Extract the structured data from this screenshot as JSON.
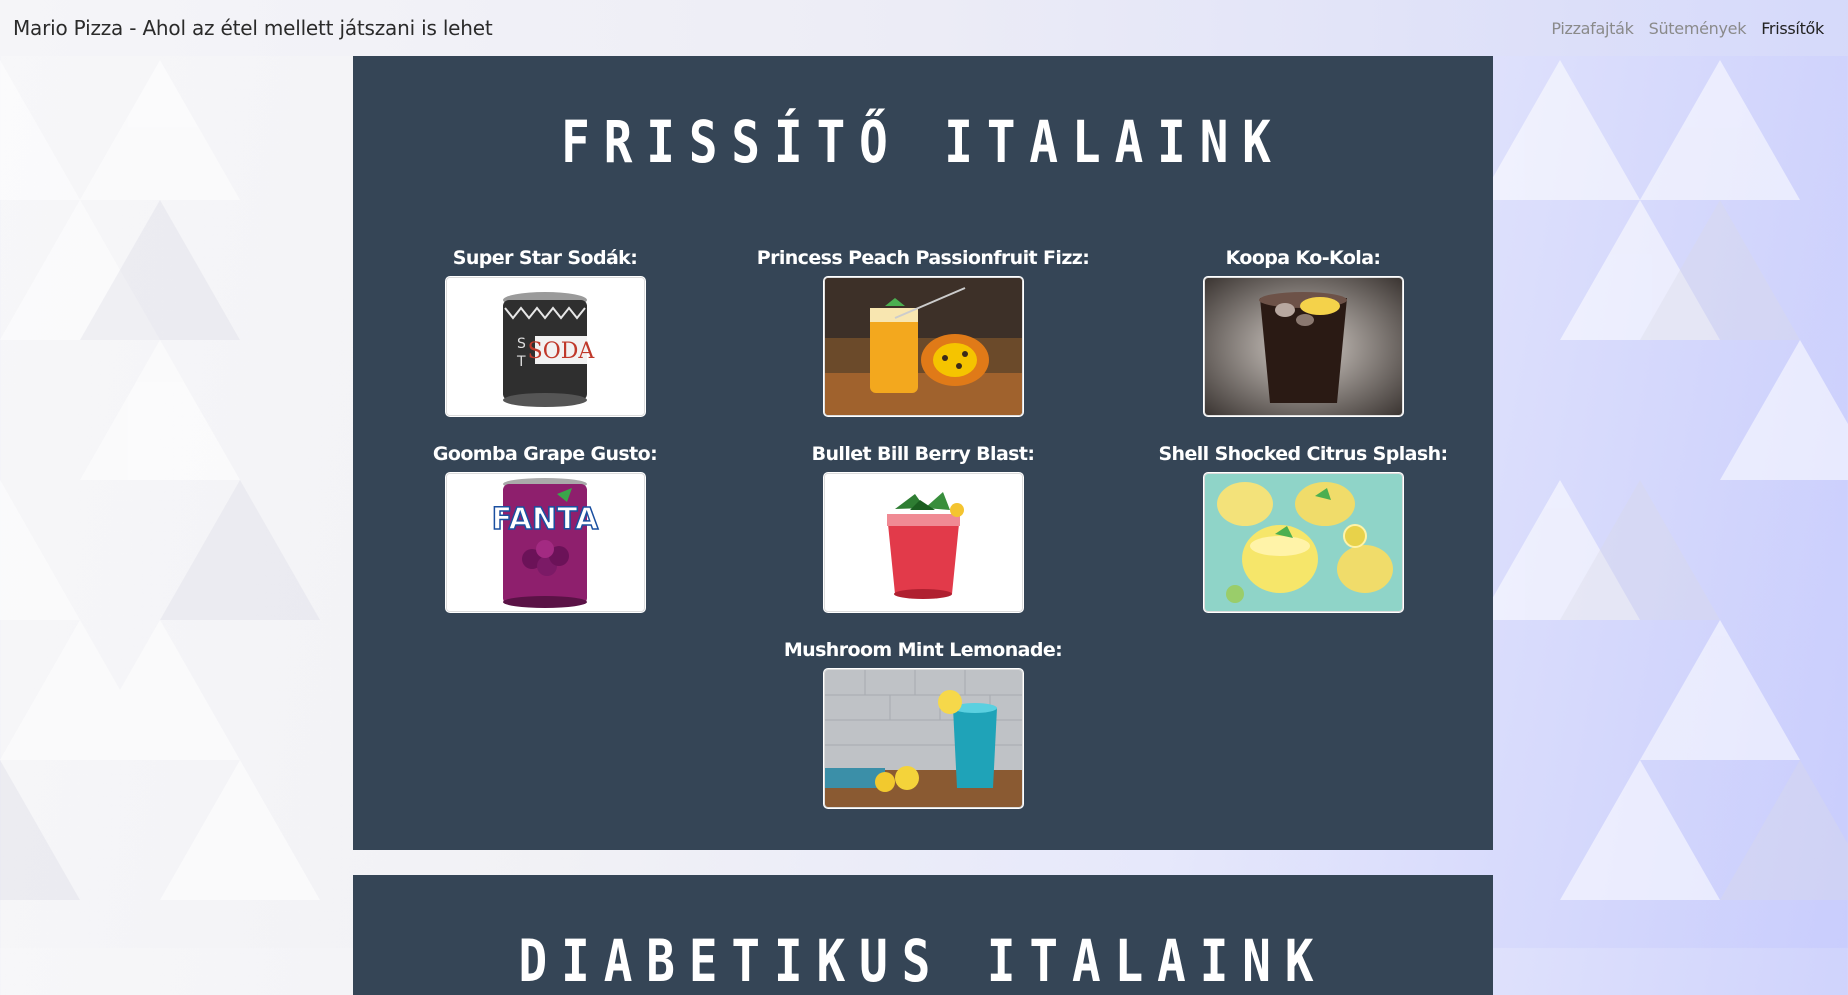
{
  "navbar": {
    "brand": "Mario Pizza - Ahol az étel mellett játszani is lehet",
    "links": [
      {
        "label": "Pizzafajták",
        "active": false
      },
      {
        "label": "Sütemények",
        "active": false
      },
      {
        "label": "Frissítők",
        "active": true
      }
    ]
  },
  "sections": [
    {
      "title": "FRISSÍTŐ ITALAINK",
      "drinks": [
        {
          "name": "Super Star Sodák:",
          "image": "star-soda-can"
        },
        {
          "name": "Princess Peach Passionfruit Fizz:",
          "image": "passionfruit-drink"
        },
        {
          "name": "Koopa Ko-Kola:",
          "image": "cola-glass"
        },
        {
          "name": "Goomba Grape Gusto:",
          "image": "grape-fanta-can"
        },
        {
          "name": "Bullet Bill Berry Blast:",
          "image": "berry-drink-glass"
        },
        {
          "name": "Shell Shocked Citrus Splash:",
          "image": "citrus-lemonade-glasses"
        },
        {
          "name": "Mushroom Mint Lemonade:",
          "image": "blue-lemonade-glass"
        }
      ]
    },
    {
      "title": "DIABETIKUS ITALAINK"
    }
  ],
  "colors": {
    "section_bg": "#354556",
    "title": "#ffffff",
    "nav_active": "#222222",
    "nav_inactive": "#8a8a8a"
  }
}
